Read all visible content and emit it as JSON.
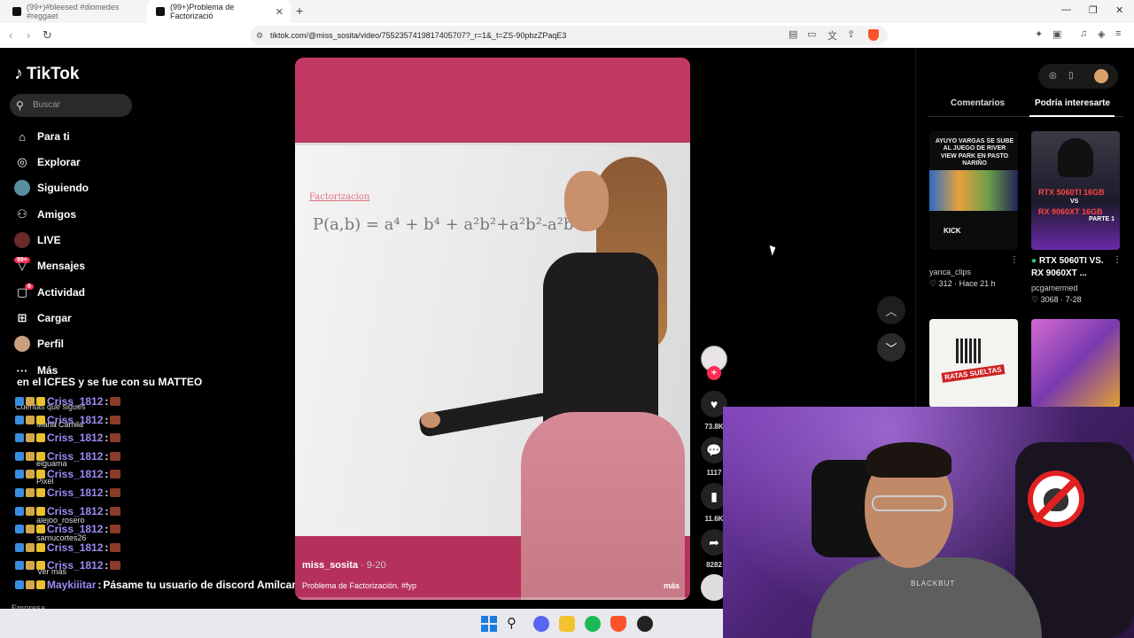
{
  "browser": {
    "tabs": [
      {
        "title": "(99+)#bleesed #diomedes #reggaet",
        "active": false
      },
      {
        "title": "(99+)Problema de Factorizació",
        "active": true
      }
    ],
    "url": "tiktok.com/@miss_sosita/video/7552357419817405707?_r=1&_t=ZS-90pbzZPaqE3",
    "icons": {
      "back": "chevron-left-icon",
      "forward": "chevron-right-icon",
      "reload": "reload-icon"
    }
  },
  "sidebar": {
    "logo": "TikTok",
    "search_placeholder": "Buscar",
    "items": [
      {
        "label": "Para ti",
        "icon": "home-icon"
      },
      {
        "label": "Explorar",
        "icon": "compass-icon"
      },
      {
        "label": "Siguiendo",
        "icon": "following-avatar"
      },
      {
        "label": "Amigos",
        "icon": "friends-icon"
      },
      {
        "label": "LIVE",
        "icon": "live-avatar"
      },
      {
        "label": "Mensajes",
        "icon": "messages-icon",
        "badge": "99+"
      },
      {
        "label": "Actividad",
        "icon": "activity-icon",
        "badge": "6"
      },
      {
        "label": "Cargar",
        "icon": "upload-icon"
      },
      {
        "label": "Perfil",
        "icon": "profile-avatar"
      },
      {
        "label": "Más",
        "icon": "more-icon"
      }
    ],
    "following_header": "Cuentas que sigues",
    "following": [
      "Maria Camila",
      "elguama",
      "Pixel",
      "alejoo_rosero",
      "samucortes26"
    ],
    "ver_mas": "Ver más",
    "footer": "Empresa"
  },
  "chat": {
    "title": "en el ICFES y se fue con su MATTEO",
    "repeat_user": "Criss_1812",
    "repeat_count": 10,
    "last_user": "Maykiiitar",
    "last_message": "Pásame tu usuario de discord Amílcar"
  },
  "video": {
    "board_heading": "Factorizacion",
    "formula": "P(a,b) = a⁴ + b⁴ + a²b²+a²b²-a²b²",
    "username": "miss_sosita",
    "date": "9-20",
    "description": "Problema de Factorización. #fyp",
    "more_label": "más",
    "progress": 0.0
  },
  "actions": {
    "likes": "73.8K",
    "comments": "1117",
    "saves": "11.6K",
    "shares": "8282"
  },
  "right_panel": {
    "tabs": [
      {
        "label": "Comentarios",
        "active": false
      },
      {
        "label": "Podría interesarte",
        "active": true
      }
    ],
    "videos": [
      {
        "thumb_title": "AYUYO VARGAS SE SUBE AL JUEGO DE RIVER VIEW PARK EN PASTO NARIÑO",
        "thumb_brand": "KICK",
        "user": "yanca_clips",
        "likes": "312",
        "time": "Hace 21 h"
      },
      {
        "thumb_line1": "RTX 5060TI 16GB",
        "thumb_vs": "VS",
        "thumb_line2": "RX 9060XT 16GB",
        "thumb_part": "PARTE 1",
        "title": "RTX 5060TI VS. RX 9060XT ...",
        "user": "pcgamermed",
        "likes": "3068",
        "time": "7-28"
      },
      {
        "thumb_label": "RATAS SUELTAS"
      },
      {
        "thumb_label": ""
      }
    ]
  },
  "webcam": {
    "shirt_text": "BLACKBUT"
  },
  "colors": {
    "accent": "#fe2c55",
    "chat_username": "#9b8cf5",
    "wall": "#c23a63"
  }
}
